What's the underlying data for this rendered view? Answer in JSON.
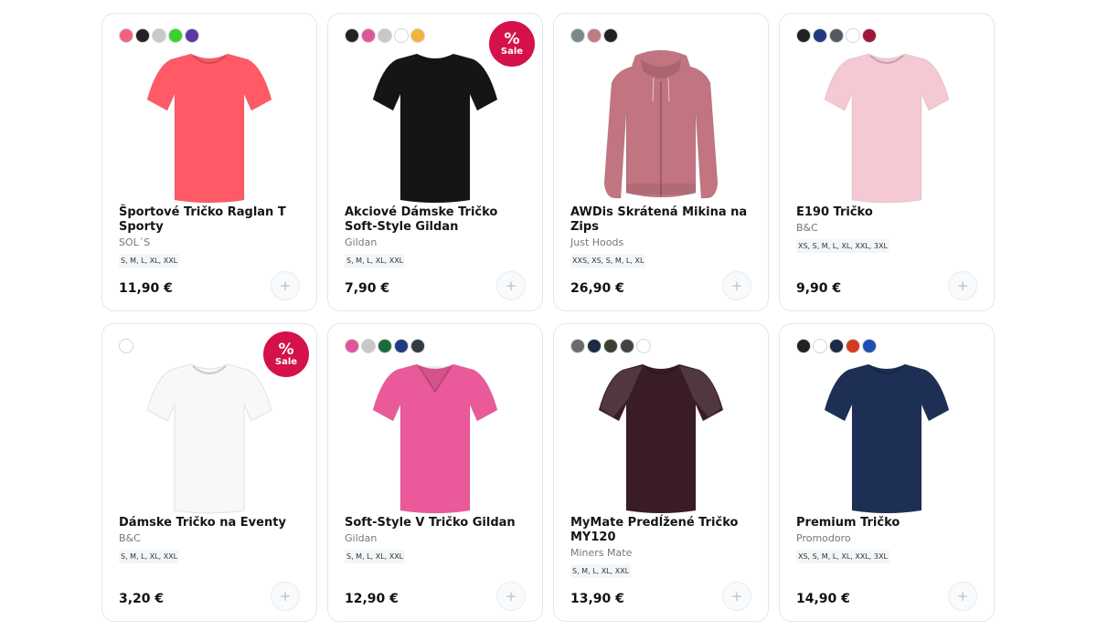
{
  "products": [
    {
      "title": "Športové Tričko Raglan T Sporty",
      "brand": "SOL´S",
      "sizes": "S, M, L, XL, XXL",
      "price": "11,90 €",
      "sale": false,
      "swatches": [
        "#f0627f",
        "#222222",
        "#c8c8c8",
        "#3bd12c",
        "#5a3aa1"
      ],
      "garment": "tee",
      "color": "#ff5a66"
    },
    {
      "title": "Akciové Dámske Tričko Soft-Style Gildan",
      "brand": "Gildan",
      "sizes": "S, M, L, XL, XXL",
      "price": "7,90 €",
      "sale": true,
      "swatches": [
        "#222222",
        "#e0549b",
        "#c8c8c8",
        "#ffffff",
        "#f3b23c"
      ],
      "garment": "tee",
      "color": "#151515"
    },
    {
      "title": "AWDis Skrátená Mikina na Zips",
      "brand": "Just Hoods",
      "sizes": "XXS, XS, S, M, L, XL",
      "price": "26,90 €",
      "sale": false,
      "swatches": [
        "#7a8a84",
        "#c07a84",
        "#222222"
      ],
      "garment": "hoodie",
      "color": "#c27481"
    },
    {
      "title": "E190 Tričko",
      "brand": "B&C",
      "sizes": "XS, S, M, L, XL, XXL, 3XL",
      "price": "9,90 €",
      "sale": false,
      "swatches": [
        "#222222",
        "#1f3b82",
        "#555a60",
        "#ffffff",
        "#a0163d"
      ],
      "garment": "tee",
      "color": "#f5c9d4"
    },
    {
      "title": "Dámske Tričko na Eventy",
      "brand": "B&C",
      "sizes": "S, M, L, XL, XXL",
      "price": "3,20 €",
      "sale": true,
      "swatches": [
        "#ffffff"
      ],
      "garment": "tee",
      "color": "#f8f8f8"
    },
    {
      "title": "Soft-Style V Tričko Gildan",
      "brand": "Gildan",
      "sizes": "S, M, L, XL, XXL",
      "price": "12,90 €",
      "sale": false,
      "swatches": [
        "#e0549b",
        "#c8c8c8",
        "#1b6a3a",
        "#1f3b82",
        "#333a44"
      ],
      "garment": "vtee",
      "color": "#ea5a9a"
    },
    {
      "title": "MyMate Predĺžené Tričko MY120",
      "brand": "Miners Mate",
      "sizes": "S, M, L, XL, XXL",
      "price": "13,90 €",
      "sale": false,
      "swatches": [
        "#6b6b6b",
        "#1c2a44",
        "#3d4030",
        "#444444",
        "#ffffff"
      ],
      "garment": "raglan",
      "color": "#3a1c25"
    },
    {
      "title": "Premium Tričko",
      "brand": "Promodoro",
      "sizes": "XS, S, M, L, XL, XXL, 3XL",
      "price": "14,90 €",
      "sale": false,
      "swatches": [
        "#222222",
        "#ffffff",
        "#1c2a44",
        "#d63a1f",
        "#1f4fb5"
      ],
      "garment": "tee",
      "color": "#1e2f55"
    }
  ],
  "sale_badge": {
    "symbol": "%",
    "label": "Sale"
  },
  "add_symbol": "+"
}
